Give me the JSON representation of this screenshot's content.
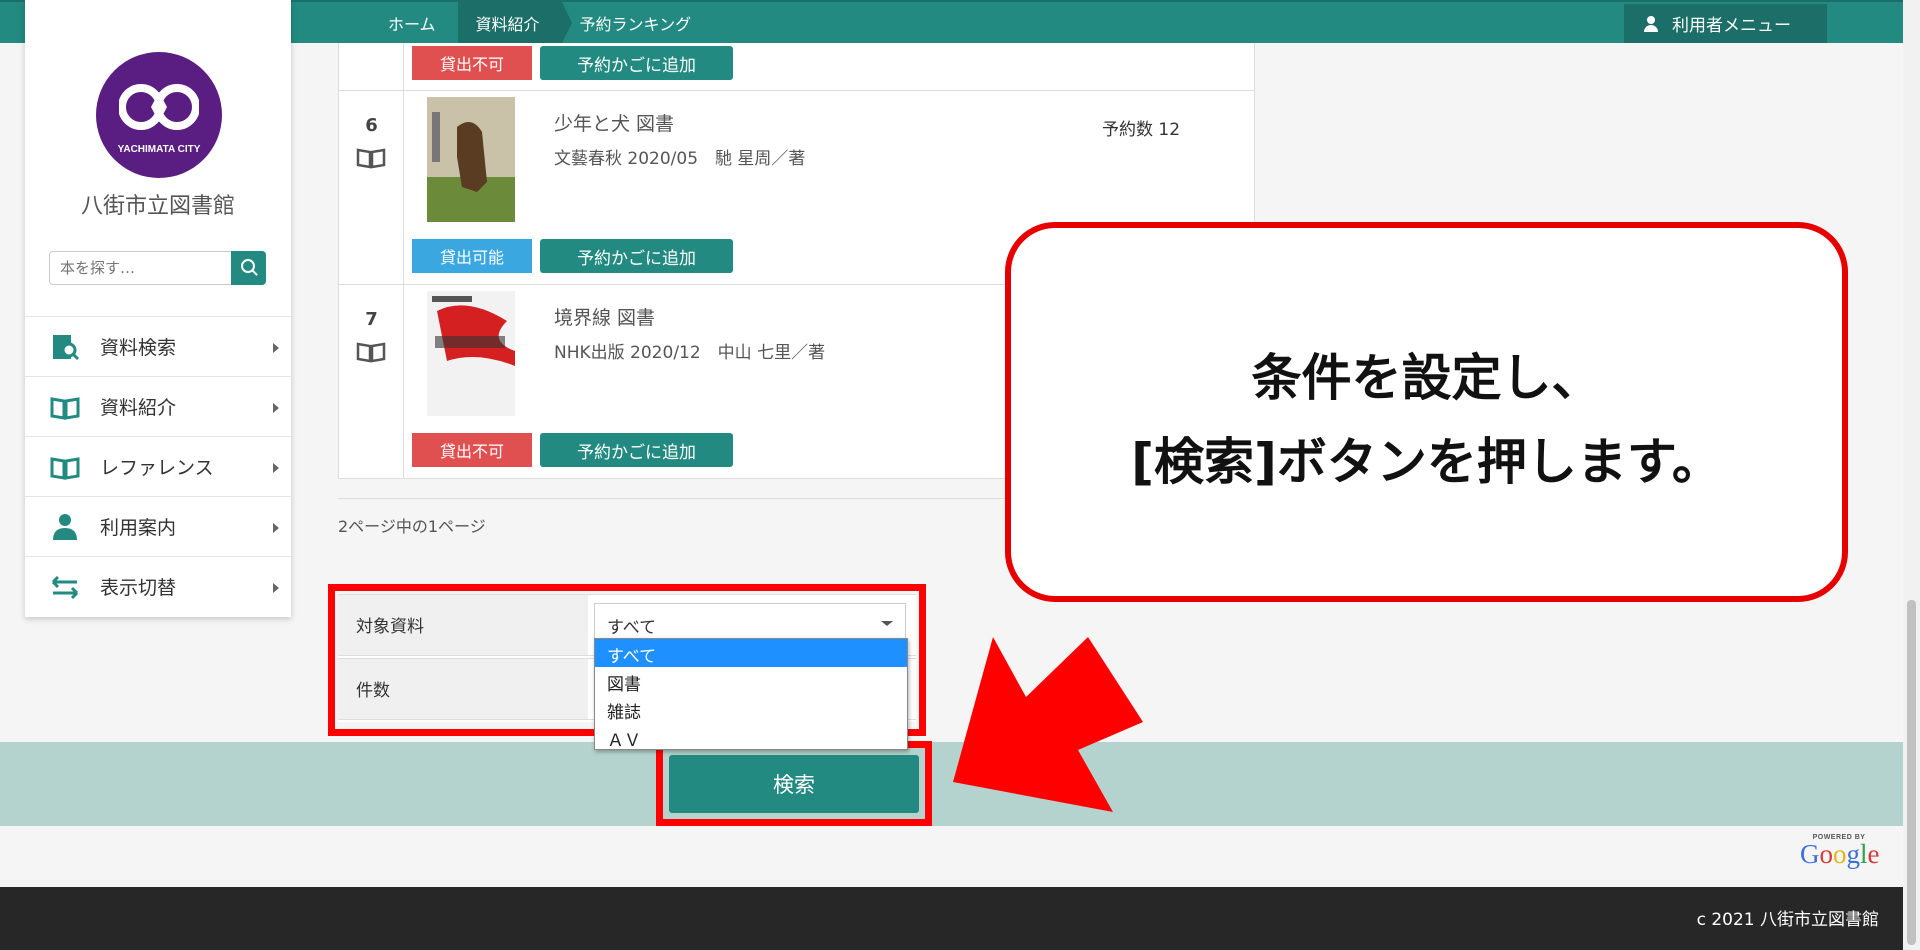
{
  "breadcrumb": [
    "ホーム",
    "資料紹介",
    "予約ランキング"
  ],
  "user_menu": "利用者メニュー",
  "sidebar": {
    "logo_text": "YACHIMATA CITY",
    "library_name": "八街市立図書館",
    "search_placeholder": "本を探す…",
    "items": [
      {
        "label": "資料検索",
        "icon": "search-book-icon"
      },
      {
        "label": "資料紹介",
        "icon": "open-book-icon"
      },
      {
        "label": "レファレンス",
        "icon": "open-book-icon"
      },
      {
        "label": "利用案内",
        "icon": "person-icon"
      },
      {
        "label": "表示切替",
        "icon": "swap-arrows-icon"
      }
    ]
  },
  "results": {
    "row5": {
      "status": "貸出不可",
      "cart": "予約かごに追加"
    },
    "row6": {
      "num": "6",
      "title": "少年と犬 図書",
      "meta": "文藝春秋 2020/05　馳 星周／著",
      "reserve": "予約数 12",
      "status": "貸出可能",
      "cart": "予約かごに追加"
    },
    "row7": {
      "num": "7",
      "title": "境界線 図書",
      "meta": "NHK出版 2020/12　中山 七里／著",
      "status": "貸出不可",
      "cart": "予約かごに追加"
    }
  },
  "page_info": "2ページ中の1ページ",
  "form": {
    "target_label": "対象資料",
    "target_value": "すべて",
    "count_label": "件数",
    "options": [
      "すべて",
      "図書",
      "雑誌",
      "ＡＶ"
    ]
  },
  "search_button": "検索",
  "powered_by": "POWERED BY",
  "google": "Google",
  "copyright": "c 2021 八街市立図書館",
  "callout": {
    "line1": "条件を設定し、",
    "line2": "[検索]ボタンを押します。"
  },
  "colors": {
    "teal": "#228a81",
    "dark_teal": "#1c6f68",
    "red": "#ff0000",
    "purple": "#5a1d82"
  }
}
